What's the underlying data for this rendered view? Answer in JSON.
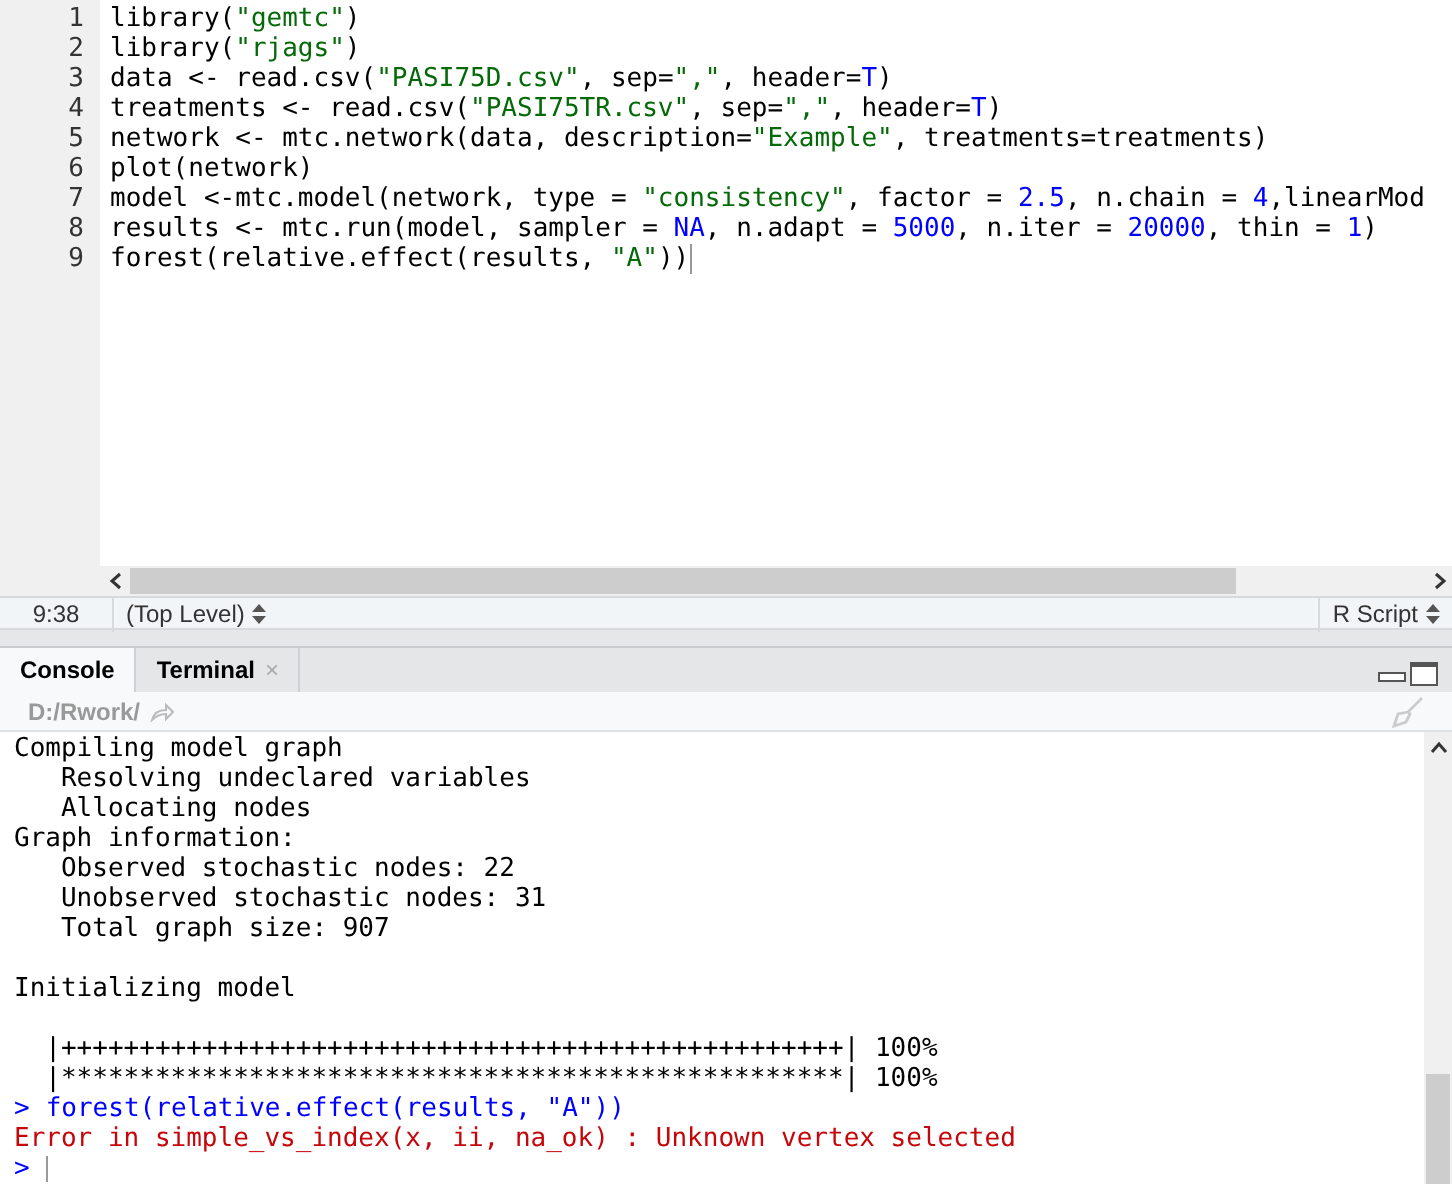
{
  "editor": {
    "lines": [
      {
        "number": "1",
        "tokens": [
          {
            "kind": "plain",
            "text": "library("
          },
          {
            "kind": "string",
            "text": "\"gemtc\""
          },
          {
            "kind": "plain",
            "text": ")"
          }
        ]
      },
      {
        "number": "2",
        "tokens": [
          {
            "kind": "plain",
            "text": "library("
          },
          {
            "kind": "string",
            "text": "\"rjags\""
          },
          {
            "kind": "plain",
            "text": ")"
          }
        ]
      },
      {
        "number": "3",
        "tokens": [
          {
            "kind": "plain",
            "text": "data <- read.csv("
          },
          {
            "kind": "string",
            "text": "\"PASI75D.csv\""
          },
          {
            "kind": "plain",
            "text": ", sep="
          },
          {
            "kind": "string",
            "text": "\",\""
          },
          {
            "kind": "plain",
            "text": ", header="
          },
          {
            "kind": "constant",
            "text": "T"
          },
          {
            "kind": "plain",
            "text": ")"
          }
        ]
      },
      {
        "number": "4",
        "tokens": [
          {
            "kind": "plain",
            "text": "treatments <- read.csv("
          },
          {
            "kind": "string",
            "text": "\"PASI75TR.csv\""
          },
          {
            "kind": "plain",
            "text": ", sep="
          },
          {
            "kind": "string",
            "text": "\",\""
          },
          {
            "kind": "plain",
            "text": ", header="
          },
          {
            "kind": "constant",
            "text": "T"
          },
          {
            "kind": "plain",
            "text": ")"
          }
        ]
      },
      {
        "number": "5",
        "tokens": [
          {
            "kind": "plain",
            "text": "network <- mtc.network(data, description="
          },
          {
            "kind": "string",
            "text": "\"Example\""
          },
          {
            "kind": "plain",
            "text": ", treatments=treatments)"
          }
        ]
      },
      {
        "number": "6",
        "tokens": [
          {
            "kind": "plain",
            "text": "plot(network)"
          }
        ]
      },
      {
        "number": "7",
        "tokens": [
          {
            "kind": "plain",
            "text": "model <-mtc.model(network, type = "
          },
          {
            "kind": "string",
            "text": "\"consistency\""
          },
          {
            "kind": "plain",
            "text": ", factor = "
          },
          {
            "kind": "constant",
            "text": "2.5"
          },
          {
            "kind": "plain",
            "text": ", n.chain = "
          },
          {
            "kind": "constant",
            "text": "4"
          },
          {
            "kind": "plain",
            "text": ",linearMod"
          }
        ]
      },
      {
        "number": "8",
        "tokens": [
          {
            "kind": "plain",
            "text": "results <- mtc.run(model, sampler = "
          },
          {
            "kind": "constant",
            "text": "NA"
          },
          {
            "kind": "plain",
            "text": ", n.adapt = "
          },
          {
            "kind": "constant",
            "text": "5000"
          },
          {
            "kind": "plain",
            "text": ", n.iter = "
          },
          {
            "kind": "constant",
            "text": "20000"
          },
          {
            "kind": "plain",
            "text": ", thin = "
          },
          {
            "kind": "constant",
            "text": "1"
          },
          {
            "kind": "plain",
            "text": ")"
          }
        ]
      },
      {
        "number": "9",
        "tokens": [
          {
            "kind": "plain",
            "text": "forest(relative.effect(results, "
          },
          {
            "kind": "string",
            "text": "\"A\""
          },
          {
            "kind": "plain",
            "text": "))"
          }
        ]
      }
    ]
  },
  "status_bar": {
    "position": "9:38",
    "scope": "(Top Level)",
    "file_type": "R Script"
  },
  "console_tabs": [
    {
      "label": "Console",
      "selected": true
    },
    {
      "label": "Terminal",
      "selected": false,
      "close": "×"
    }
  ],
  "console_path": "D:/Rwork/",
  "console_lines": [
    {
      "kind": "output",
      "text": "Compiling model graph"
    },
    {
      "kind": "output",
      "text": "   Resolving undeclared variables"
    },
    {
      "kind": "output",
      "text": "   Allocating nodes"
    },
    {
      "kind": "output",
      "text": "Graph information:"
    },
    {
      "kind": "output",
      "text": "   Observed stochastic nodes: 22"
    },
    {
      "kind": "output",
      "text": "   Unobserved stochastic nodes: 31"
    },
    {
      "kind": "output",
      "text": "   Total graph size: 907"
    },
    {
      "kind": "blank"
    },
    {
      "kind": "output",
      "text": "Initializing model"
    },
    {
      "kind": "blank"
    },
    {
      "kind": "output",
      "text": "  |++++++++++++++++++++++++++++++++++++++++++++++++++| 100%"
    },
    {
      "kind": "output",
      "text": "  |**************************************************| 100%"
    },
    {
      "kind": "input",
      "prompt": ">",
      "text": "forest(relative.effect(results, \"A\"))"
    },
    {
      "kind": "error",
      "text": "Error in simple_vs_index(x, ii, na_ok) : Unknown vertex selected"
    },
    {
      "kind": "prompt",
      "prompt": ">"
    }
  ]
}
